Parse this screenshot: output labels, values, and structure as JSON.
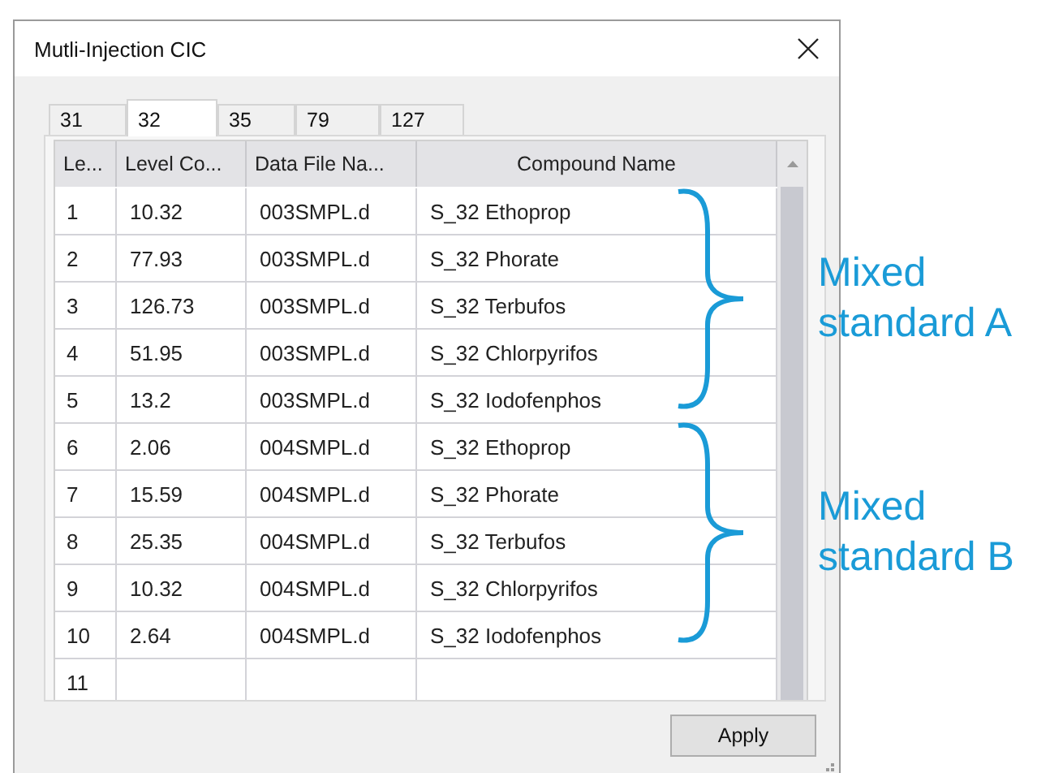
{
  "window": {
    "title": "Mutli-Injection CIC"
  },
  "tabs": [
    {
      "label": "31",
      "selected": false
    },
    {
      "label": "32",
      "selected": true
    },
    {
      "label": "35",
      "selected": false
    },
    {
      "label": "79",
      "selected": false
    },
    {
      "label": "127",
      "selected": false
    }
  ],
  "table": {
    "columns": [
      "Le...",
      "Level Co...",
      "Data File Na...",
      "Compound Name"
    ],
    "rows": [
      [
        "1",
        "10.32",
        "003SMPL.d",
        "S_32 Ethoprop"
      ],
      [
        "2",
        "77.93",
        "003SMPL.d",
        "S_32 Phorate"
      ],
      [
        "3",
        "126.73",
        "003SMPL.d",
        "S_32 Terbufos"
      ],
      [
        "4",
        "51.95",
        "003SMPL.d",
        "S_32 Chlorpyrifos"
      ],
      [
        "5",
        "13.2",
        "003SMPL.d",
        "S_32 Iodofenphos"
      ],
      [
        "6",
        "2.06",
        "004SMPL.d",
        "S_32 Ethoprop"
      ],
      [
        "7",
        "15.59",
        "004SMPL.d",
        "S_32 Phorate"
      ],
      [
        "8",
        "25.35",
        "004SMPL.d",
        "S_32 Terbufos"
      ],
      [
        "9",
        "10.32",
        "004SMPL.d",
        "S_32 Chlorpyrifos"
      ],
      [
        "10",
        "2.64",
        "004SMPL.d",
        "S_32 Iodofenphos"
      ],
      [
        "11"
      ]
    ]
  },
  "buttons": [
    "Apply"
  ],
  "annotations": [
    {
      "label": "Mixed standard A"
    },
    {
      "label": "Mixed standard B"
    }
  ]
}
